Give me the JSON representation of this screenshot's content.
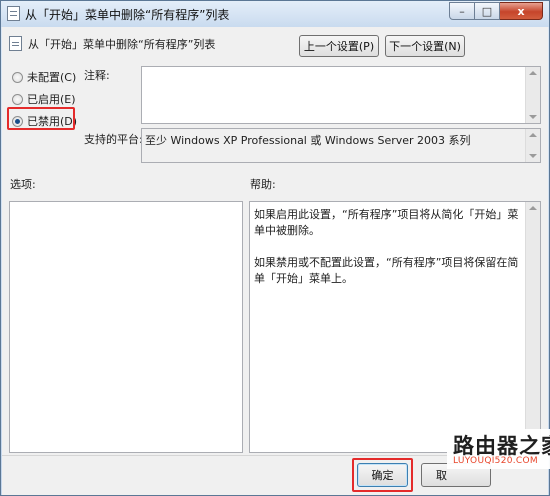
{
  "window": {
    "title": "从「开始」菜单中删除“所有程序”列表",
    "minimize": "–",
    "maximize": "□",
    "close": "x"
  },
  "header": {
    "policy_name": "从「开始」菜单中删除“所有程序”列表",
    "prev_button": "上一个设置(P)",
    "next_button": "下一个设置(N)"
  },
  "state": {
    "options": [
      {
        "label": "未配置(C)",
        "checked": false
      },
      {
        "label": "已启用(E)",
        "checked": false
      },
      {
        "label": "已禁用(D)",
        "checked": true
      }
    ]
  },
  "fields": {
    "comment_label": "注释:",
    "comment_value": "",
    "platform_label": "支持的平台:",
    "platform_value": "至少 Windows XP Professional 或 Windows Server 2003 系列"
  },
  "panels": {
    "options_label": "选项:",
    "help_label": "帮助:",
    "help_paragraphs": [
      "如果启用此设置，“所有程序”项目将从简化「开始」菜单中被删除。",
      "如果禁用或不配置此设置，“所有程序”项目将保留在简单「开始」菜单上。"
    ]
  },
  "footer": {
    "ok": "确定",
    "cancel": "取"
  },
  "watermark": {
    "text": "路由器之家",
    "url": "LUYOUQI520.COM"
  },
  "colors": {
    "highlight": "#e42b2b",
    "watermark_url": "#e8452a"
  }
}
